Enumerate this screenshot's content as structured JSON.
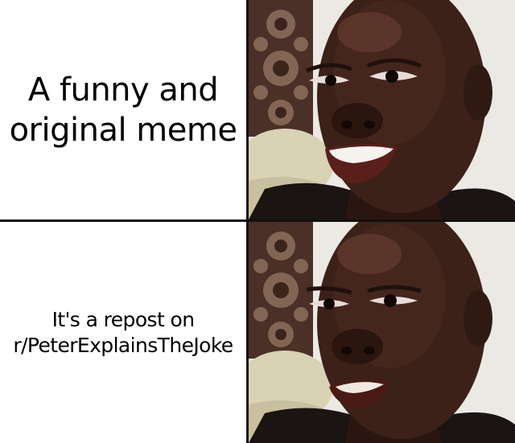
{
  "meme": {
    "top_caption": "A funny and original meme",
    "bottom_caption": "It's a repost on r/PeterExplainsTheJoke"
  },
  "colors": {
    "skin": "#3b2118",
    "skin_dark": "#1f100b",
    "skin_highlight": "#6a4033",
    "wallpaper": "#ebe9e4",
    "carving": "#5a3c2e",
    "pillow": "#d9d2b4",
    "shirt": "#1a1413",
    "divider": "#111111"
  },
  "icons": {
    "top_image": "happy-man-image",
    "bottom_image": "disappointed-man-image"
  }
}
